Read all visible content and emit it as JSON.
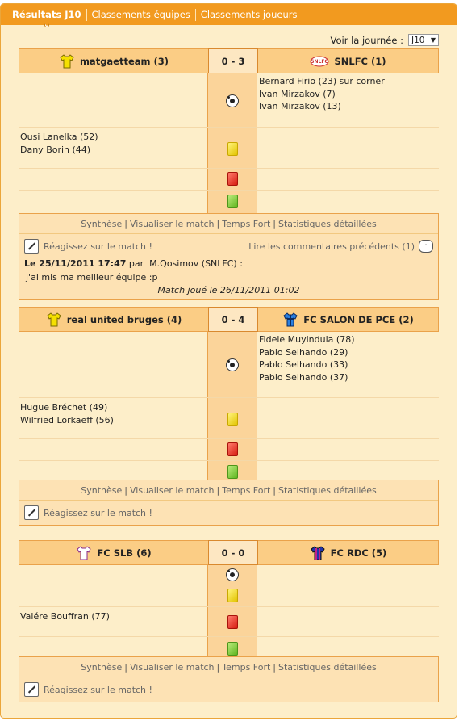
{
  "tabs": [
    {
      "label": "Résultats J10",
      "active": true
    },
    {
      "label": "Classements équipes",
      "active": false
    },
    {
      "label": "Classements joueurs",
      "active": false
    }
  ],
  "journee": {
    "label": "Voir la journée :",
    "value": "J10"
  },
  "footer_links": {
    "synthese": "Synthèse",
    "visualiser": "Visualiser le match",
    "temps_fort": "Temps Fort",
    "stats": "Statistiques détaillées"
  },
  "react_label": "Réagissez sur le match !",
  "colors": {
    "tab_bar": "#f29a1f",
    "header": "#fbcd85",
    "background": "#fdeec9"
  },
  "matches": [
    {
      "home": {
        "name": "matgaetteam (3)",
        "shirt_icon": "yellow-shirt-icon"
      },
      "away": {
        "name": "SNLFC (1)",
        "shirt_icon": "snlfc-logo-icon"
      },
      "score": "0 - 3",
      "goals_home": [],
      "goals_away": [
        "Bernard Firio (23) sur corner",
        "Ivan Mirzakov (7)",
        "Ivan Mirzakov (13)"
      ],
      "yellow_home": [
        "Ousi Lanelka (52)",
        "Dany Borin (44)"
      ],
      "comments_link": "Lire les commentaires précédents (1)",
      "comment": {
        "datetime": "Le 25/11/2011 17:47",
        "par": "par",
        "author": "M.Qosimov (SNLFC) :",
        "text": "j'ai mis ma meilleur équipe :p",
        "played": "Match joué le 26/11/2011 01:02"
      }
    },
    {
      "home": {
        "name": "real united bruges (4)",
        "shirt_icon": "yellow-shirt-icon"
      },
      "away": {
        "name": "FC SALON DE PCE (2)",
        "shirt_icon": "blue-striped-shirt-icon"
      },
      "score": "0 - 4",
      "goals_home": [],
      "goals_away": [
        "Fidele Muyindula (78)",
        "Pablo Selhando (29)",
        "Pablo Selhando (33)",
        "Pablo Selhando (37)"
      ],
      "yellow_home": [
        "Hugue Bréchet (49)",
        "Wilfried Lorkaeff (56)"
      ]
    },
    {
      "home": {
        "name": "FC SLB (6)",
        "shirt_icon": "white-shirt-icon"
      },
      "away": {
        "name": "FC RDC (5)",
        "shirt_icon": "purple-striped-shirt-icon"
      },
      "score": "0 - 0",
      "goals_home": [],
      "goals_away": [],
      "yellow_home": [
        "Valére Bouffran (77)"
      ]
    }
  ]
}
